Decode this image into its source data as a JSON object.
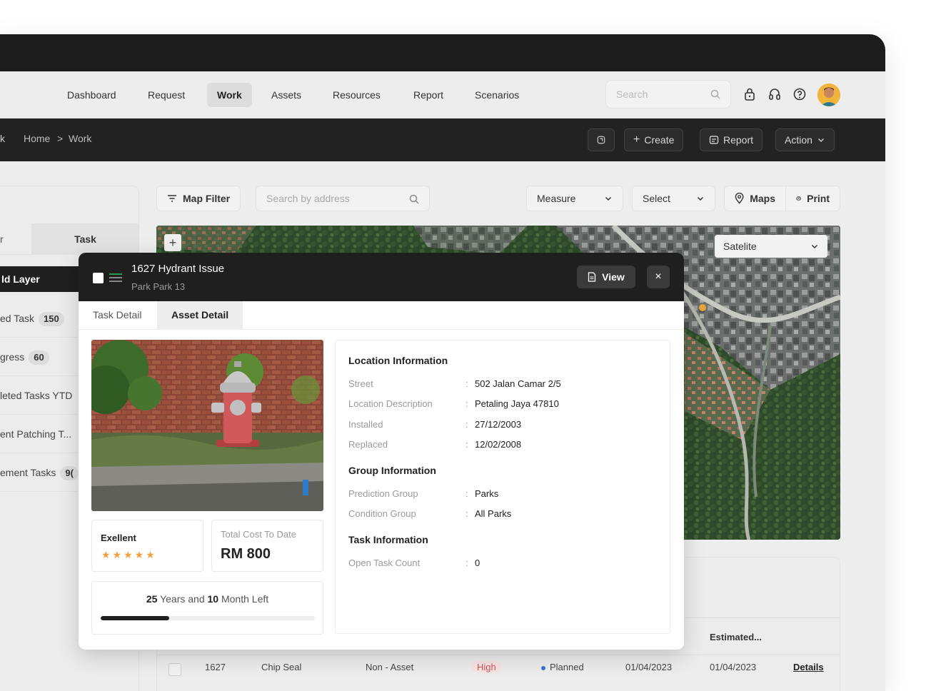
{
  "nav": {
    "items": [
      "Dashboard",
      "Request",
      "Work",
      "Assets",
      "Resources",
      "Report",
      "Scenarios"
    ],
    "active": "Work",
    "search_placeholder": "Search"
  },
  "breadcrumb": {
    "stub": "k",
    "home": "Home",
    "separator": ">",
    "current": "Work"
  },
  "crumb_actions": {
    "create": "Create",
    "report": "Report",
    "action": "Action"
  },
  "left_panel": {
    "tab_stub": "r",
    "tab_task": "Task",
    "layer_head": "ld Layer",
    "rows": [
      {
        "label": "ed Task",
        "count": "150"
      },
      {
        "label": "gress",
        "count": "60"
      },
      {
        "label": "leted Tasks YTD",
        "count": ""
      },
      {
        "label": "ent Patching T...",
        "count": ""
      },
      {
        "label": "ement Tasks",
        "count": "9("
      }
    ]
  },
  "toolbar": {
    "map_filter": "Map Filter",
    "address_placeholder": "Search by address",
    "measure": "Measure",
    "select": "Select",
    "maps": "Maps",
    "print": "Print"
  },
  "map": {
    "plus": "+",
    "layer_select": "Satelite"
  },
  "table": {
    "header_estimated": "Estimated...",
    "row": {
      "id": "1627",
      "type": "Chip Seal",
      "asset": "Non - Asset",
      "priority": "High",
      "status": "Planned",
      "start": "01/04/2023",
      "estimated": "01/04/2023",
      "details": "Details"
    },
    "colors": {
      "priority_bg": "#f6e4e4",
      "priority_text": "#d25555",
      "status_dot": "#3a6fd8"
    }
  },
  "popup": {
    "title": "1627 Hydrant Issue",
    "subtitle": "Park Park 13",
    "view": "View",
    "close": "×",
    "tabs": [
      "Task Detail",
      "Asset Detail"
    ],
    "active_tab": "Asset Detail",
    "condition_label": "Exellent",
    "rating": 5,
    "stars": "★★★★★",
    "cost_label": "Total Cost To Date",
    "cost_value": "RM 800",
    "life": {
      "years": "25",
      "years_word": "Years and",
      "months": "10",
      "months_word": "Month Left",
      "progress": 0.32
    },
    "location": {
      "title": "Location Information",
      "fields": [
        {
          "label": "Street",
          "value": "502 Jalan Camar 2/5"
        },
        {
          "label": "Location Description",
          "value": "Petaling Jaya 47810"
        },
        {
          "label": "Installed",
          "value": "27/12/2003"
        },
        {
          "label": "Replaced",
          "value": "12/02/2008"
        }
      ]
    },
    "group": {
      "title": "Group Information",
      "fields": [
        {
          "label": "Prediction Group",
          "value": "Parks"
        },
        {
          "label": "Condition Group",
          "value": "All Parks"
        }
      ]
    },
    "task": {
      "title": "Task Information",
      "fields": [
        {
          "label": "Open Task Count",
          "value": "0"
        }
      ]
    }
  }
}
